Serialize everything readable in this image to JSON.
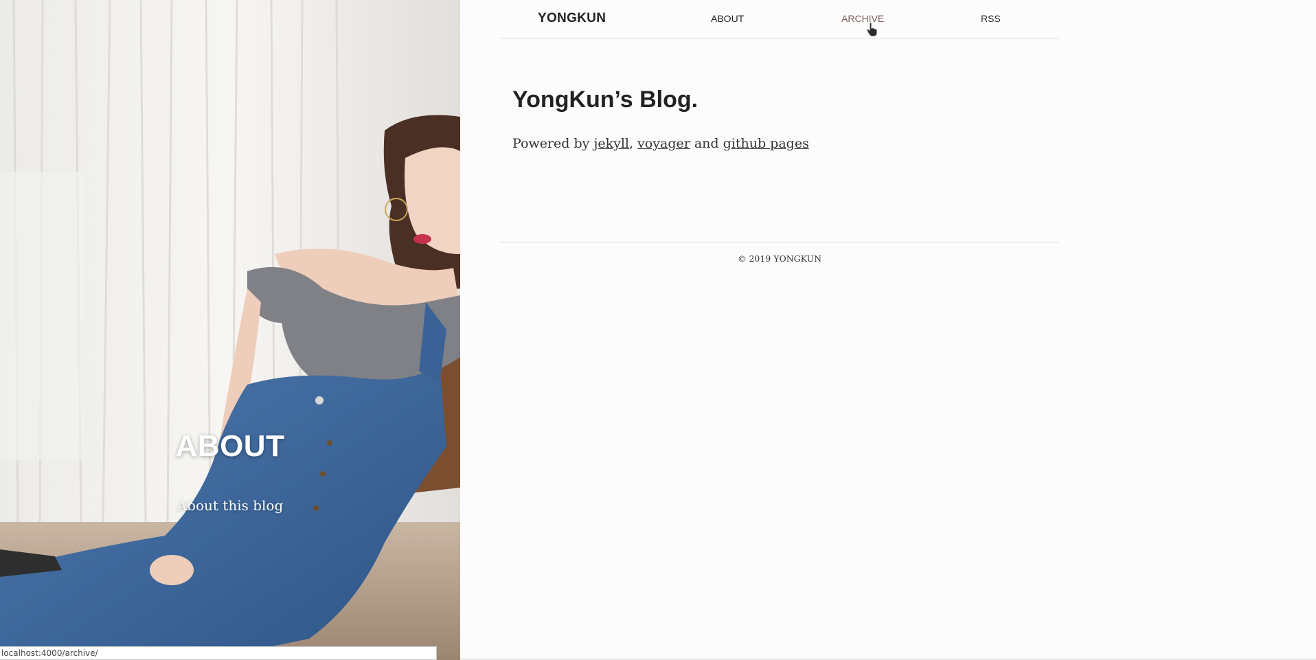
{
  "hero": {
    "title": "ABOUT",
    "subtitle": "About this blog"
  },
  "nav": {
    "brand": "YONGKUN",
    "links": [
      {
        "label": "ABOUT"
      },
      {
        "label": "ARCHIVE"
      },
      {
        "label": "RSS"
      }
    ]
  },
  "main": {
    "title": "YongKun’s Blog.",
    "powered_prefix": "Powered by ",
    "link_jekyll": "jekyll",
    "sep1": ", ",
    "link_voyager": "voyager",
    "sep2": " and ",
    "link_github": "github pages"
  },
  "footer": {
    "copyright": "© 2019 YONGKUN"
  },
  "status_bar": {
    "url": "localhost:4000/archive/"
  },
  "colors": {
    "accent_hover": "#7a5a58",
    "text": "#222222",
    "background": "#fcfcfc"
  }
}
